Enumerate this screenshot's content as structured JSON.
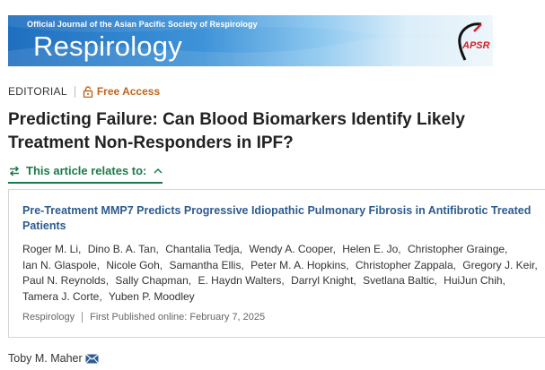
{
  "journal": {
    "subtitle": "Official Journal of the Asian Pacific Society of Respirology",
    "name": "Respirology",
    "logo_text": "APSR"
  },
  "article": {
    "type": "EDITORIAL",
    "access": "Free Access",
    "title": "Predicting Failure: Can Blood Biomarkers Identify Likely Treatment Non-Responders in IPF?",
    "author": "Toby M. Maher"
  },
  "relates": {
    "label": "This article relates to:"
  },
  "related_article": {
    "title": "Pre-Treatment MMP7 Predicts Progressive Idiopathic Pulmonary Fibrosis in Antifibrotic Treated Patients",
    "authors": [
      "Roger M. Li,",
      "Dino B. A. Tan,",
      "Chantalia Tedja,",
      "Wendy A. Cooper,",
      "Helen E. Jo,",
      "Christopher Grainge,",
      "Ian N. Glaspole,",
      "Nicole Goh,",
      "Samantha Ellis,",
      "Peter M. A. Hopkins,",
      "Christopher Zappala,",
      "Gregory J. Keir,",
      "Paul N. Reynolds,",
      "Sally Chapman,",
      "E. Haydn Walters,",
      "Darryl Knight,",
      "Svetlana Baltic,",
      "HuiJun Chih,",
      "Tamera J. Corte,",
      "Yuben P. Moodley"
    ],
    "journal": "Respirology",
    "published": "First Published online: February 7, 2025"
  },
  "colors": {
    "accent_green": "#1a7a4a",
    "free_access": "#c0651b",
    "link_blue": "#2d5b8f",
    "logo_red": "#d0202a"
  }
}
